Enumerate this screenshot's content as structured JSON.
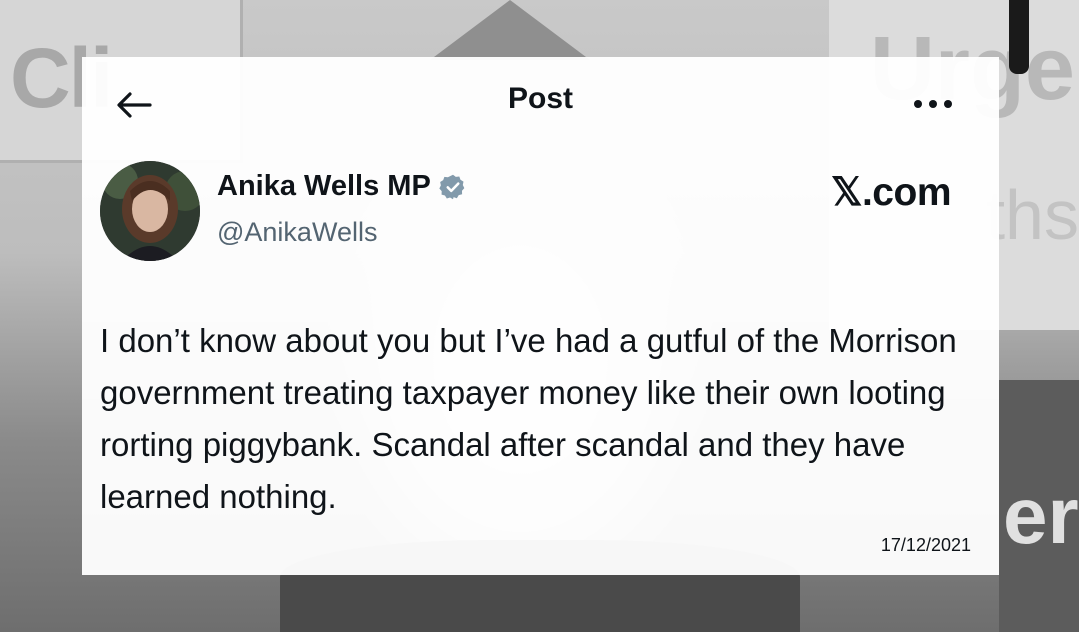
{
  "header": {
    "title": "Post"
  },
  "author": {
    "name": "Anika Wells MP",
    "handle": "@AnikaWells"
  },
  "watermark": "𝕏.com",
  "post": {
    "text": "I don’t know about you but I’ve had a gutful of the Morrison government treating taxpayer money like their own looting rorting piggybank. Scandal after scandal and they have learned nothing.",
    "date": "17/12/2021"
  },
  "icons": {
    "back": "arrow-left-icon",
    "more": "more-horizontal-icon",
    "verified": "verified-badge-icon"
  },
  "colors": {
    "text_primary": "#0f1419",
    "text_secondary": "#536471",
    "verified_badge": "#829aab",
    "card_background": "#ffffff"
  }
}
